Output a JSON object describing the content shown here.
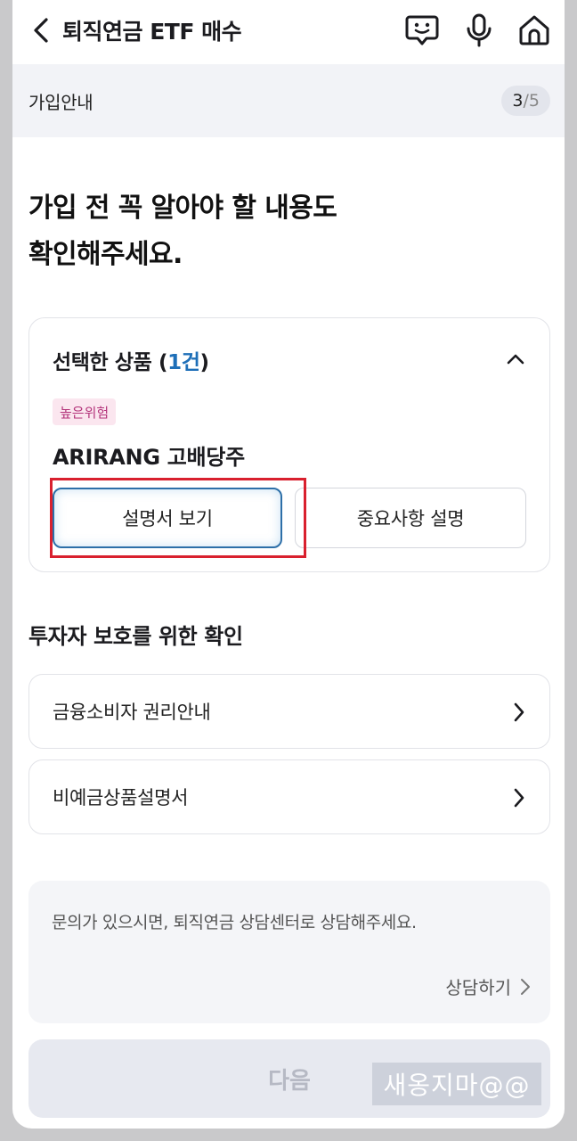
{
  "header": {
    "title": "퇴직연금 ETF 매수",
    "icons": [
      "back-icon",
      "chatbot-icon",
      "microphone-icon",
      "home-icon"
    ]
  },
  "step": {
    "label": "가입안내",
    "current": "3",
    "separator": "/",
    "total": "5"
  },
  "heading": {
    "line1": "가입 전 꼭 알아야 할 내용도",
    "line2": "확인해주세요."
  },
  "product_card": {
    "title_prefix": "선택한 상품 (",
    "count": "1건",
    "title_suffix": ")",
    "risk_tag": "높은위험",
    "product_name": "ARIRANG 고배당주",
    "view_button": "설명서 보기",
    "important_button": "중요사항 설명"
  },
  "investor_protection": {
    "title": "투자자 보호를 위한 확인",
    "items": [
      {
        "label": "금융소비자 권리안내"
      },
      {
        "label": "비예금상품설명서"
      }
    ]
  },
  "inquiry": {
    "text": "문의가 있으시면, 퇴직연금 상담센터로 상담해주세요.",
    "consult_label": "상담하기"
  },
  "next_button": "다음",
  "watermark": "새옹지마@@",
  "colors": {
    "accent": "#1e6fb8",
    "highlight": "#d9202e",
    "risk_bg": "#fbe6ef",
    "risk_text": "#b3337a"
  }
}
